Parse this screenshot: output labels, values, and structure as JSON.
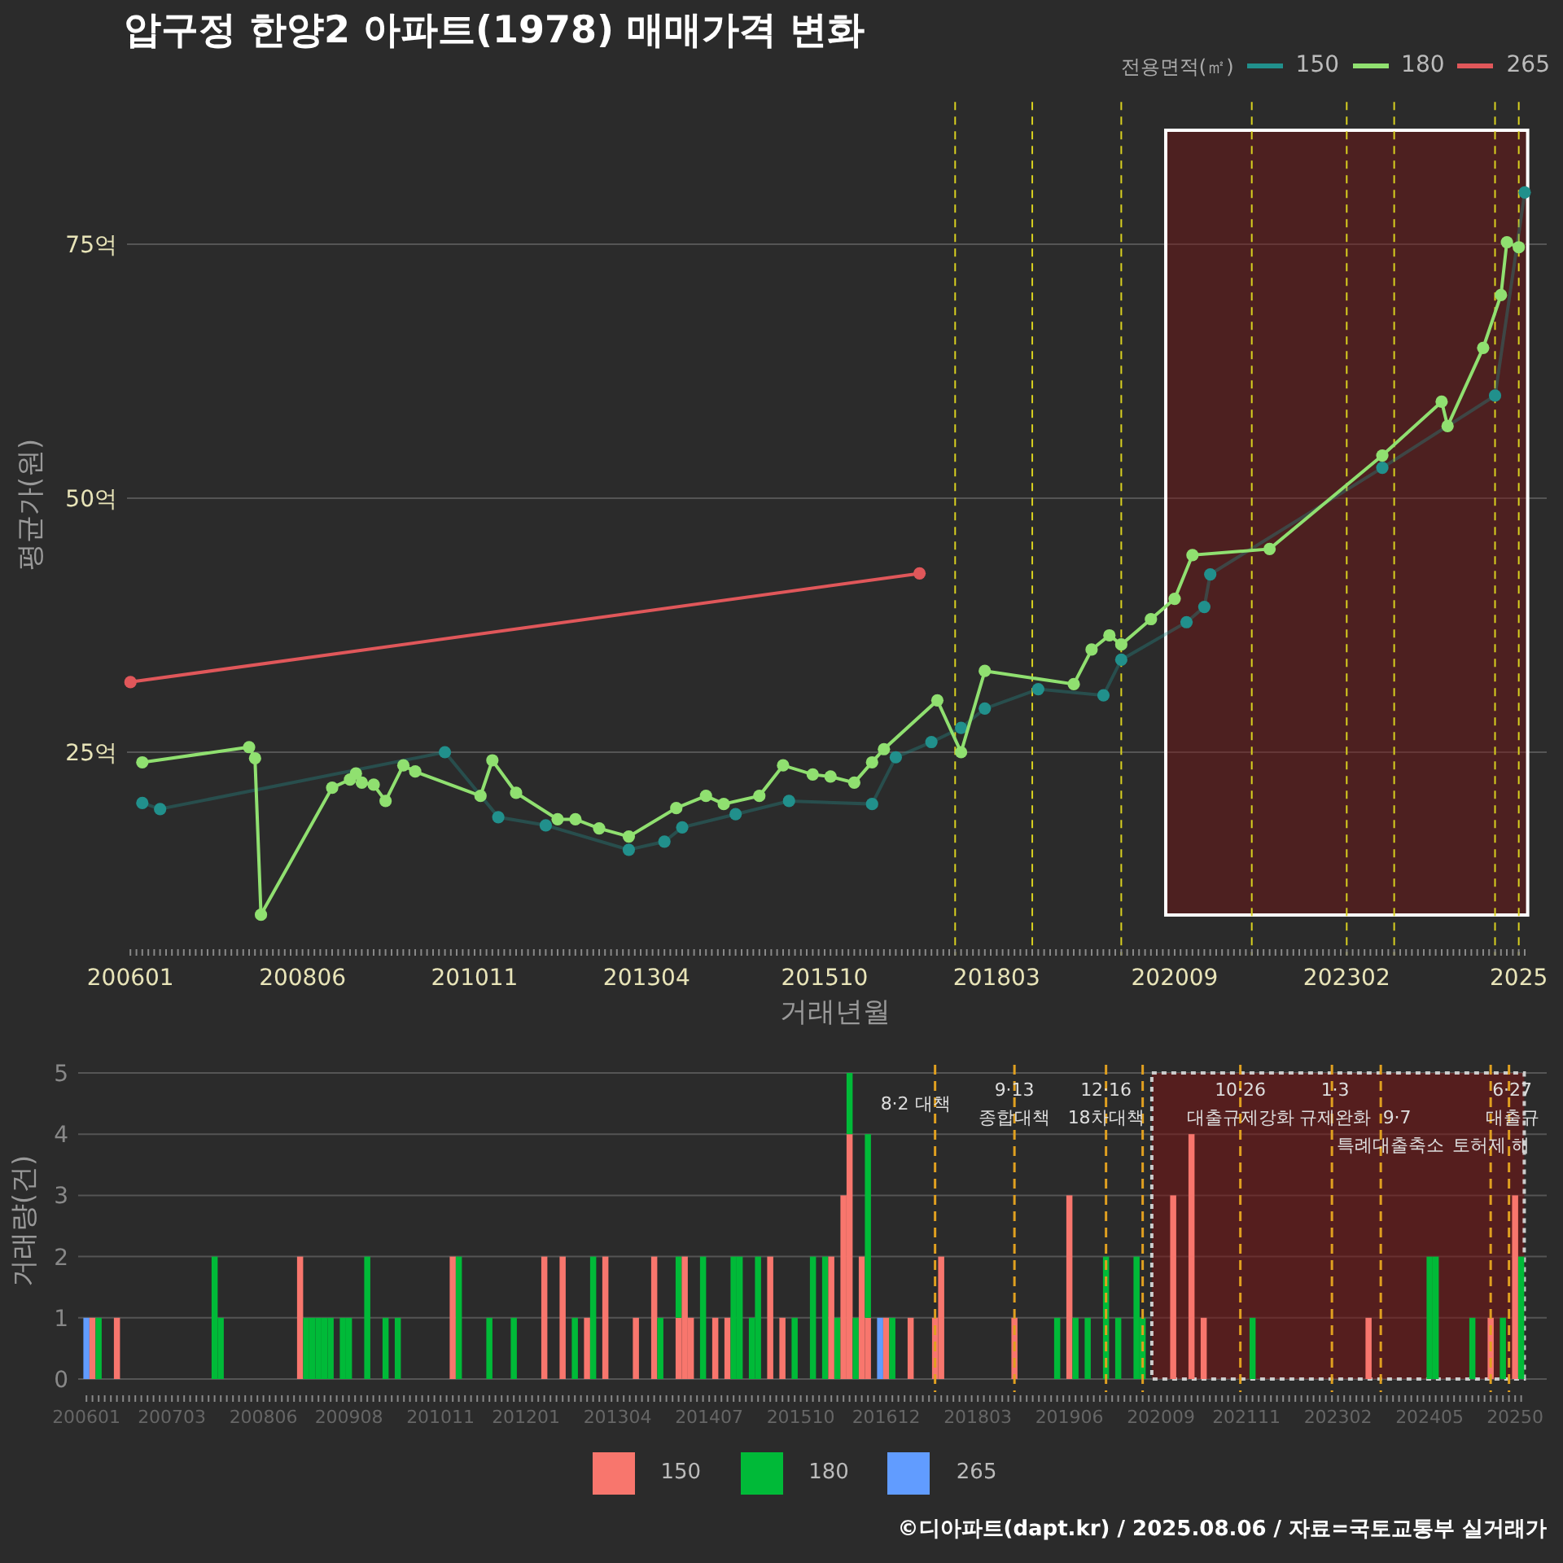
{
  "title": "압구정 한양2 아파트(1978) 매매가격 변화",
  "top_chart": {
    "legend_title": "전용면적(㎡)",
    "chart_data": {
      "type": "line",
      "xlabel": "거래년월",
      "ylabel": "평균가(원)",
      "categories": [
        "200601",
        null,
        null,
        null,
        null,
        null,
        null,
        null,
        null,
        null,
        null,
        null,
        null,
        null,
        null,
        null,
        null,
        null,
        null,
        null,
        null,
        null,
        null,
        null,
        null,
        null,
        null,
        null,
        null,
        "200806",
        null,
        null,
        null,
        null,
        null,
        null,
        null,
        null,
        null,
        null,
        null,
        null,
        null,
        null,
        null,
        null,
        null,
        null,
        null,
        null,
        null,
        null,
        null,
        null,
        null,
        null,
        null,
        null,
        "201011",
        null,
        null,
        null,
        null,
        null,
        null,
        null,
        null,
        null,
        null,
        null,
        null,
        null,
        null,
        null,
        null,
        null,
        null,
        null,
        null,
        null,
        null,
        null,
        null,
        null,
        null,
        null,
        null,
        "201304",
        null,
        null,
        null,
        null,
        null,
        null,
        null,
        null,
        null,
        null,
        null,
        null,
        null,
        null,
        null,
        null,
        null,
        null,
        null,
        null,
        null,
        null,
        null,
        null,
        null,
        null,
        null,
        null,
        null,
        "201510",
        null,
        null,
        null,
        null,
        null,
        null,
        null,
        null,
        null,
        null,
        null,
        null,
        null,
        null,
        null,
        null,
        null,
        null,
        null,
        null,
        null,
        null,
        null,
        null,
        null,
        null,
        null,
        null,
        "201803",
        null,
        null,
        null,
        null,
        null,
        null,
        null,
        null,
        null,
        null,
        null,
        null,
        null,
        null,
        null,
        null,
        null,
        null,
        null,
        null,
        null,
        null,
        null,
        null,
        null,
        null,
        null,
        null,
        null,
        "202009",
        null,
        null,
        null,
        null,
        null,
        null,
        null,
        null,
        null,
        null,
        null,
        null,
        null,
        null,
        null,
        null,
        null,
        null,
        null,
        null,
        null,
        null,
        null,
        null,
        null,
        null,
        null,
        null,
        "202302",
        null,
        null,
        null,
        null,
        null,
        null,
        null,
        null,
        null,
        null,
        null,
        null,
        null,
        null,
        null,
        null,
        null,
        null,
        null,
        null,
        null,
        null,
        null,
        null,
        null,
        null,
        null,
        null,
        "2025",
        null
      ],
      "series": [
        {
          "name": "150",
          "color": "#21908c",
          "marker": "circle",
          "values": [
            null,
            null,
            20.0,
            null,
            null,
            19.4,
            null,
            null,
            null,
            null,
            null,
            null,
            null,
            null,
            null,
            null,
            null,
            null,
            null,
            null,
            null,
            null,
            null,
            null,
            null,
            null,
            null,
            null,
            null,
            null,
            null,
            null,
            null,
            null,
            null,
            null,
            null,
            null,
            null,
            null,
            null,
            null,
            null,
            null,
            null,
            null,
            null,
            null,
            null,
            null,
            null,
            null,
            null,
            25.0,
            null,
            null,
            null,
            null,
            null,
            null,
            null,
            null,
            18.6,
            null,
            null,
            null,
            null,
            null,
            null,
            null,
            17.8,
            null,
            null,
            null,
            null,
            null,
            null,
            null,
            null,
            null,
            null,
            null,
            null,
            null,
            15.4,
            null,
            null,
            null,
            null,
            null,
            16.2,
            null,
            null,
            17.6,
            null,
            null,
            null,
            null,
            null,
            null,
            null,
            null,
            18.9,
            null,
            null,
            null,
            null,
            null,
            null,
            null,
            null,
            20.2,
            null,
            null,
            null,
            null,
            null,
            null,
            null,
            null,
            null,
            null,
            null,
            null,
            null,
            19.9,
            null,
            null,
            null,
            24.5,
            null,
            null,
            null,
            null,
            null,
            26.0,
            null,
            null,
            null,
            null,
            27.4,
            null,
            null,
            null,
            29.3,
            null,
            null,
            null,
            null,
            null,
            null,
            null,
            null,
            31.2,
            null,
            null,
            null,
            null,
            null,
            null,
            null,
            null,
            null,
            null,
            30.6,
            null,
            null,
            34.1,
            null,
            null,
            null,
            null,
            null,
            null,
            null,
            null,
            null,
            null,
            37.8,
            null,
            null,
            39.3,
            42.5,
            null,
            null,
            null,
            null,
            null,
            null,
            null,
            null,
            null,
            null,
            null,
            null,
            null,
            null,
            null,
            null,
            null,
            null,
            null,
            null,
            null,
            null,
            null,
            null,
            null,
            null,
            null,
            null,
            53.0,
            null,
            null,
            null,
            null,
            null,
            null,
            null,
            null,
            null,
            null,
            null,
            null,
            null,
            null,
            null,
            null,
            null,
            null,
            60.1,
            null,
            null,
            null,
            null,
            80.1
          ]
        },
        {
          "name": "180",
          "color": "#90e070",
          "marker": "circle",
          "values": [
            null,
            null,
            24.0,
            null,
            null,
            null,
            null,
            null,
            null,
            null,
            null,
            null,
            null,
            null,
            null,
            null,
            null,
            null,
            null,
            null,
            25.5,
            24.4,
            9.0,
            null,
            null,
            null,
            null,
            null,
            null,
            null,
            null,
            null,
            null,
            null,
            21.5,
            null,
            null,
            22.3,
            22.9,
            22.0,
            null,
            21.8,
            null,
            20.2,
            null,
            null,
            23.7,
            null,
            23.1,
            null,
            null,
            null,
            null,
            null,
            null,
            null,
            null,
            null,
            null,
            20.7,
            null,
            24.2,
            null,
            null,
            null,
            21.0,
            null,
            null,
            null,
            null,
            null,
            null,
            18.4,
            null,
            null,
            18.4,
            null,
            null,
            null,
            17.5,
            null,
            null,
            null,
            null,
            16.7,
            null,
            null,
            null,
            null,
            null,
            null,
            null,
            19.5,
            null,
            null,
            null,
            null,
            20.7,
            null,
            null,
            19.9,
            null,
            null,
            null,
            null,
            null,
            20.7,
            null,
            null,
            null,
            23.7,
            null,
            null,
            null,
            null,
            22.8,
            null,
            null,
            22.6,
            null,
            null,
            null,
            22.0,
            null,
            null,
            24.0,
            null,
            25.3,
            null,
            null,
            null,
            null,
            null,
            null,
            null,
            null,
            30.1,
            null,
            null,
            null,
            25.0,
            null,
            null,
            null,
            33.0,
            null,
            null,
            null,
            null,
            null,
            null,
            null,
            null,
            null,
            null,
            null,
            null,
            null,
            null,
            31.7,
            null,
            null,
            35.1,
            null,
            null,
            36.5,
            null,
            35.6,
            null,
            null,
            null,
            null,
            38.1,
            null,
            null,
            null,
            40.1,
            null,
            null,
            44.4,
            null,
            null,
            null,
            null,
            null,
            null,
            null,
            null,
            null,
            null,
            null,
            null,
            45.0,
            null,
            null,
            null,
            null,
            null,
            null,
            null,
            null,
            null,
            null,
            null,
            null,
            null,
            null,
            null,
            null,
            null,
            null,
            54.2,
            null,
            null,
            null,
            null,
            null,
            null,
            null,
            null,
            null,
            59.5,
            57.1,
            null,
            null,
            null,
            null,
            null,
            64.8,
            null,
            null,
            70.0,
            75.2,
            null,
            74.7,
            null
          ]
        },
        {
          "name": "265",
          "color": "#e0575a",
          "marker": "circle",
          "values": [
            31.9,
            null,
            null,
            null,
            null,
            null,
            null,
            null,
            null,
            null,
            null,
            null,
            null,
            null,
            null,
            null,
            null,
            null,
            null,
            null,
            null,
            null,
            null,
            null,
            null,
            null,
            null,
            null,
            null,
            null,
            null,
            null,
            null,
            null,
            null,
            null,
            null,
            null,
            null,
            null,
            null,
            null,
            null,
            null,
            null,
            null,
            null,
            null,
            null,
            null,
            null,
            null,
            null,
            null,
            null,
            null,
            null,
            null,
            null,
            null,
            null,
            null,
            null,
            null,
            null,
            null,
            null,
            null,
            null,
            null,
            null,
            null,
            null,
            null,
            null,
            null,
            null,
            null,
            null,
            null,
            null,
            null,
            null,
            null,
            null,
            null,
            null,
            null,
            null,
            null,
            null,
            null,
            null,
            null,
            null,
            null,
            null,
            null,
            null,
            null,
            null,
            null,
            null,
            null,
            null,
            null,
            null,
            null,
            null,
            null,
            null,
            null,
            null,
            null,
            null,
            null,
            null,
            null,
            null,
            null,
            null,
            null,
            null,
            null,
            null,
            null,
            null,
            null,
            null,
            null,
            null,
            null,
            null,
            42.6,
            null,
            null,
            null,
            null,
            null,
            null,
            null,
            null,
            null,
            null,
            null,
            null,
            null,
            null,
            null,
            null,
            null,
            null,
            null,
            null,
            null,
            null,
            null,
            null,
            null,
            null,
            null,
            null,
            null,
            null,
            null,
            null,
            null,
            null,
            null,
            null,
            null,
            null,
            null,
            null,
            null,
            null,
            null,
            null,
            null,
            null,
            null,
            null,
            null,
            null,
            null,
            null,
            null,
            null,
            null,
            null,
            null,
            null,
            null,
            null,
            null,
            null,
            null,
            null,
            null,
            null,
            null,
            null,
            null,
            null,
            null,
            null,
            null,
            null,
            null,
            null,
            null,
            null,
            null,
            null,
            null,
            null,
            null,
            null,
            null,
            null,
            null,
            null,
            null,
            null,
            null,
            null,
            null,
            null,
            null,
            null,
            null,
            null,
            null,
            null,
            null,
            null
          ]
        }
      ],
      "grid": true,
      "ylim": [
        5,
        89
      ],
      "yticks": [
        {
          "value": 25,
          "label": "25억"
        },
        {
          "value": 50,
          "label": "50억"
        },
        {
          "value": 75,
          "label": "75억"
        }
      ]
    }
  },
  "bottom_chart": {
    "chart_data": {
      "type": "bar",
      "stacked": true,
      "ylabel": "거래량(건)",
      "categories": [
        "200601",
        null,
        null,
        null,
        null,
        null,
        null,
        null,
        null,
        null,
        null,
        null,
        null,
        null,
        "200703",
        null,
        null,
        null,
        null,
        null,
        null,
        null,
        null,
        null,
        null,
        null,
        null,
        null,
        null,
        "200806",
        null,
        null,
        null,
        null,
        null,
        null,
        null,
        null,
        null,
        null,
        null,
        null,
        null,
        "200908",
        null,
        null,
        null,
        null,
        null,
        null,
        null,
        null,
        null,
        null,
        null,
        null,
        null,
        null,
        "201011",
        null,
        null,
        null,
        null,
        null,
        null,
        null,
        null,
        null,
        null,
        null,
        null,
        null,
        "201201",
        null,
        null,
        null,
        null,
        null,
        null,
        null,
        null,
        null,
        null,
        null,
        null,
        null,
        null,
        "201304",
        null,
        null,
        null,
        null,
        null,
        null,
        null,
        null,
        null,
        null,
        null,
        null,
        null,
        null,
        "201407",
        null,
        null,
        null,
        null,
        null,
        null,
        null,
        null,
        null,
        null,
        null,
        null,
        null,
        null,
        "201510",
        null,
        null,
        null,
        null,
        null,
        null,
        null,
        null,
        null,
        null,
        null,
        null,
        null,
        "201612",
        null,
        null,
        null,
        null,
        null,
        null,
        null,
        null,
        null,
        null,
        null,
        null,
        null,
        null,
        "201803",
        null,
        null,
        null,
        null,
        null,
        null,
        null,
        null,
        null,
        null,
        null,
        null,
        null,
        null,
        "201906",
        null,
        null,
        null,
        null,
        null,
        null,
        null,
        null,
        null,
        null,
        null,
        null,
        null,
        null,
        "202009",
        null,
        null,
        null,
        null,
        null,
        null,
        null,
        null,
        null,
        null,
        null,
        null,
        null,
        "202111",
        null,
        null,
        null,
        null,
        null,
        null,
        null,
        null,
        null,
        null,
        null,
        null,
        null,
        null,
        "202302",
        null,
        null,
        null,
        null,
        null,
        null,
        null,
        null,
        null,
        null,
        null,
        null,
        null,
        null,
        "202405",
        null,
        null,
        null,
        null,
        null,
        null,
        null,
        null,
        null,
        null,
        null,
        null,
        null,
        "20250",
        null
      ],
      "series": [
        {
          "name": "150",
          "color": "#f8766d",
          "values": [
            null,
            1,
            null,
            null,
            null,
            1,
            null,
            null,
            null,
            null,
            null,
            null,
            null,
            null,
            null,
            null,
            null,
            null,
            null,
            null,
            null,
            null,
            null,
            null,
            null,
            null,
            null,
            null,
            null,
            null,
            null,
            null,
            null,
            null,
            null,
            2,
            null,
            null,
            null,
            null,
            null,
            null,
            null,
            null,
            null,
            null,
            null,
            null,
            null,
            null,
            null,
            null,
            null,
            null,
            null,
            null,
            null,
            null,
            null,
            null,
            2,
            null,
            null,
            null,
            null,
            null,
            null,
            null,
            null,
            null,
            null,
            null,
            null,
            null,
            null,
            2,
            null,
            null,
            2,
            null,
            null,
            null,
            1,
            null,
            null,
            2,
            null,
            null,
            null,
            null,
            1,
            null,
            null,
            2,
            null,
            null,
            null,
            1,
            2,
            1,
            null,
            null,
            null,
            1,
            null,
            1,
            null,
            null,
            null,
            null,
            null,
            null,
            2,
            null,
            1,
            null,
            null,
            null,
            null,
            null,
            null,
            null,
            2,
            null,
            3,
            4,
            null,
            2,
            1,
            null,
            null,
            1,
            null,
            null,
            null,
            1,
            null,
            null,
            null,
            1,
            2,
            null,
            null,
            null,
            null,
            null,
            null,
            null,
            null,
            null,
            null,
            null,
            1,
            null,
            null,
            null,
            null,
            null,
            null,
            null,
            null,
            3,
            null,
            null,
            null,
            null,
            null,
            null,
            null,
            null,
            null,
            null,
            null,
            null,
            null,
            null,
            null,
            null,
            3,
            null,
            null,
            4,
            null,
            1,
            null,
            null,
            null,
            null,
            null,
            null,
            null,
            null,
            null,
            null,
            null,
            null,
            null,
            null,
            null,
            null,
            null,
            null,
            null,
            null,
            null,
            null,
            null,
            null,
            null,
            null,
            1,
            null,
            null,
            null,
            null,
            null,
            null,
            null,
            null,
            null,
            null,
            null,
            null,
            null,
            null,
            null,
            null,
            null,
            null,
            null,
            1,
            null,
            null,
            null,
            3,
            null
          ]
        },
        {
          "name": "180",
          "color": "#00ba38",
          "values": [
            null,
            null,
            1,
            null,
            null,
            null,
            null,
            null,
            null,
            null,
            null,
            null,
            null,
            null,
            null,
            null,
            null,
            null,
            null,
            null,
            null,
            2,
            1,
            null,
            null,
            null,
            null,
            null,
            null,
            null,
            null,
            null,
            null,
            null,
            null,
            null,
            1,
            1,
            1,
            1,
            1,
            null,
            1,
            1,
            null,
            null,
            2,
            null,
            null,
            1,
            null,
            1,
            null,
            null,
            null,
            null,
            null,
            null,
            null,
            null,
            null,
            2,
            null,
            null,
            null,
            null,
            1,
            null,
            null,
            null,
            1,
            null,
            null,
            null,
            null,
            null,
            null,
            null,
            null,
            null,
            1,
            null,
            null,
            2,
            null,
            null,
            null,
            null,
            null,
            null,
            null,
            null,
            null,
            null,
            1,
            null,
            null,
            1,
            null,
            null,
            null,
            2,
            null,
            null,
            null,
            null,
            2,
            2,
            null,
            1,
            2,
            null,
            null,
            null,
            null,
            null,
            1,
            null,
            null,
            2,
            null,
            2,
            null,
            1,
            null,
            1,
            1,
            null,
            3,
            null,
            null,
            null,
            1,
            null,
            null,
            null,
            null,
            null,
            null,
            null,
            null,
            null,
            null,
            null,
            null,
            null,
            null,
            null,
            null,
            null,
            null,
            null,
            null,
            null,
            null,
            null,
            null,
            null,
            null,
            1,
            null,
            null,
            1,
            null,
            1,
            null,
            null,
            2,
            null,
            1,
            null,
            null,
            2,
            1,
            null,
            null,
            null,
            null,
            null,
            null,
            null,
            null,
            null,
            null,
            null,
            null,
            null,
            null,
            null,
            null,
            null,
            1,
            null,
            null,
            null,
            null,
            null,
            null,
            null,
            null,
            null,
            null,
            null,
            null,
            null,
            null,
            null,
            null,
            null,
            null,
            null,
            null,
            null,
            null,
            null,
            null,
            null,
            null,
            null,
            null,
            2,
            2,
            null,
            null,
            null,
            null,
            null,
            1,
            null,
            null,
            null,
            null,
            1,
            null,
            null,
            2
          ]
        },
        {
          "name": "265",
          "color": "#619cff",
          "values": [
            1,
            null,
            null,
            null,
            null,
            null,
            null,
            null,
            null,
            null,
            null,
            null,
            null,
            null,
            null,
            null,
            null,
            null,
            null,
            null,
            null,
            null,
            null,
            null,
            null,
            null,
            null,
            null,
            null,
            null,
            null,
            null,
            null,
            null,
            null,
            null,
            null,
            null,
            null,
            null,
            null,
            null,
            null,
            null,
            null,
            null,
            null,
            null,
            null,
            null,
            null,
            null,
            null,
            null,
            null,
            null,
            null,
            null,
            null,
            null,
            null,
            null,
            null,
            null,
            null,
            null,
            null,
            null,
            null,
            null,
            null,
            null,
            null,
            null,
            null,
            null,
            null,
            null,
            null,
            null,
            null,
            null,
            null,
            null,
            null,
            null,
            null,
            null,
            null,
            null,
            null,
            null,
            null,
            null,
            null,
            null,
            null,
            null,
            null,
            null,
            null,
            null,
            null,
            null,
            null,
            null,
            null,
            null,
            null,
            null,
            null,
            null,
            null,
            null,
            null,
            null,
            null,
            null,
            null,
            null,
            null,
            null,
            null,
            null,
            null,
            null,
            null,
            null,
            null,
            null,
            1,
            null,
            null,
            null,
            null,
            null,
            null,
            null,
            null,
            null,
            null,
            null,
            null,
            null,
            null,
            null,
            null,
            null,
            null,
            null,
            null,
            null,
            null,
            null,
            null,
            null,
            null,
            null,
            null,
            null,
            null,
            null,
            null,
            null,
            null,
            null,
            null,
            null,
            null,
            null,
            null,
            null,
            null,
            null,
            null,
            null,
            null,
            null,
            null,
            null,
            null,
            null,
            null,
            null,
            null,
            null,
            null,
            null,
            null,
            null,
            null,
            null,
            null,
            null,
            null,
            null,
            null,
            null,
            null,
            null,
            null,
            null,
            null,
            null,
            null,
            null,
            null,
            null,
            null,
            null,
            null,
            null,
            null,
            null,
            null,
            null,
            null,
            null,
            null,
            null,
            null,
            null,
            null,
            null,
            null,
            null,
            null,
            null,
            null,
            null,
            null,
            null,
            null,
            null,
            null,
            null
          ]
        }
      ],
      "ylim": [
        0,
        5
      ],
      "grid": true,
      "yticks": [
        0,
        1,
        2,
        3,
        4,
        5
      ],
      "annotations": [
        "8·2 대책",
        "9·13",
        "종합대책",
        "12·16",
        "18차대책",
        "10·26",
        "대출규제강화",
        "1·3",
        "규제완화",
        "9·7",
        "특례대출축소",
        "6·27",
        "대출규",
        "토허제 해"
      ]
    }
  },
  "footer": "©디아파트(dapt.kr) / 2025.08.06 / 자료=국토교통부 실거래가"
}
